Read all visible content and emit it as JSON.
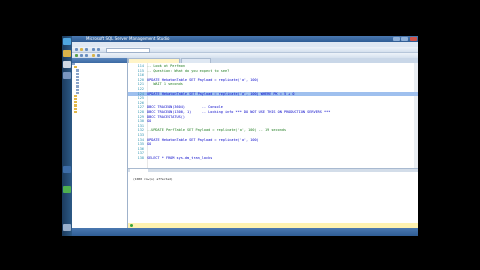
{
  "window": {
    "title": "Microsoft SQL Server Management Studio"
  },
  "editor": {
    "lines": [
      {
        "num": "114",
        "text": "-- Look at Perfmon",
        "style": "comment"
      },
      {
        "num": "115",
        "text": "-- Question: What do you expect to see?",
        "style": "comment"
      },
      {
        "num": "116",
        "text": "",
        "style": "plain"
      },
      {
        "num": "120",
        "text": "UPDATE HekatonTable SET Payload = replicate('a', 100)",
        "style": "kw"
      },
      {
        "num": "121",
        "text": "   WAIT 1 seconds",
        "style": "comment"
      },
      {
        "num": "122",
        "text": "",
        "style": "plain"
      },
      {
        "num": "124",
        "text": "UPDATE HekatonTable SET Payload = replicate('a', 100) WHERE PK = 5 + 0",
        "style": "sel"
      },
      {
        "num": "125",
        "text": "",
        "style": "plain"
      },
      {
        "num": "126",
        "text": "",
        "style": "plain"
      },
      {
        "num": "127",
        "text": "DBCC TRACEON(3604)        -- Console",
        "style": "kw"
      },
      {
        "num": "128",
        "text": "DBCC TRACEON(1300, 1)     -- Locking info *** DO NOT USE THIS ON PRODUCTION SERVERS ***",
        "style": "kw"
      },
      {
        "num": "129",
        "text": "DBCC TRACESTATUS()",
        "style": "kw"
      },
      {
        "num": "130",
        "text": "GO",
        "style": "kw"
      },
      {
        "num": "131",
        "text": "",
        "style": "plain"
      },
      {
        "num": "132",
        "text": "--UPDATE PerfTable SET Payload = replicate('a', 100) -- 19 seconds",
        "style": "comment"
      },
      {
        "num": "133",
        "text": "",
        "style": "plain"
      },
      {
        "num": "134",
        "text": "UPDATE HekatonTable SET Payload = replicate('a', 100)",
        "style": "kw"
      },
      {
        "num": "135",
        "text": "GO",
        "style": "kw"
      },
      {
        "num": "136",
        "text": "",
        "style": "plain"
      },
      {
        "num": "137",
        "text": "",
        "style": "plain"
      },
      {
        "num": "138",
        "text": "SELECT * FROM sys.dm_tran_locks",
        "style": "kw"
      }
    ],
    "results": {
      "message": "(1000 row(s) affected)"
    }
  },
  "colors": {
    "accent": "#2f5d95",
    "status": "#fff2b0",
    "selection": "#9fc0ee"
  }
}
